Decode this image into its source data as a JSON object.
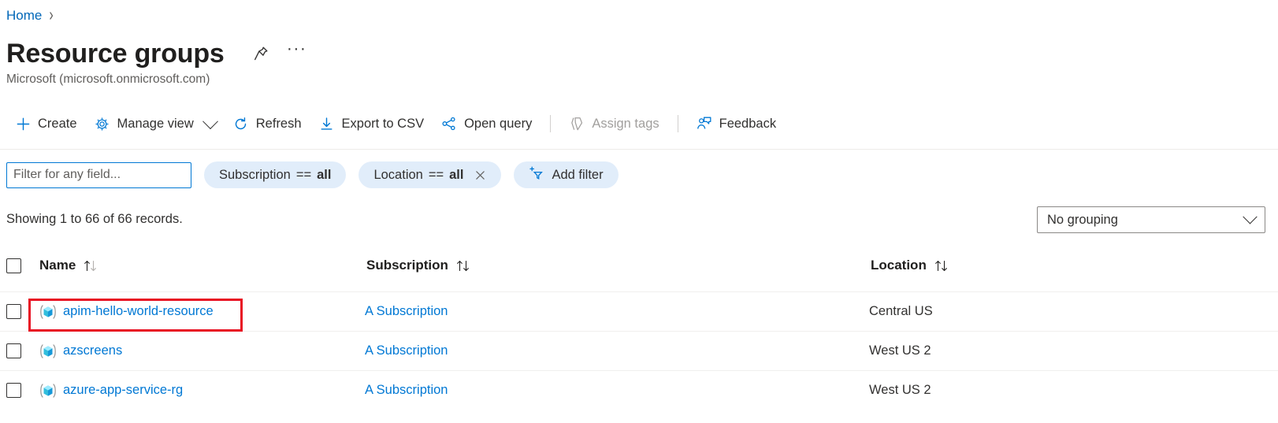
{
  "breadcrumb": {
    "home": "Home",
    "separator": "›"
  },
  "header": {
    "title": "Resource groups",
    "subtitle": "Microsoft (microsoft.onmicrosoft.com)",
    "pin_icon": "pin-icon",
    "more_icon": "ellipsis-icon",
    "more_label": "···"
  },
  "commandbar": {
    "items": [
      {
        "label": "Create",
        "icon": "plus-icon",
        "disabled": false,
        "chevron": false
      },
      {
        "label": "Manage view",
        "icon": "gear-icon",
        "disabled": false,
        "chevron": true
      },
      {
        "label": "Refresh",
        "icon": "refresh-icon",
        "disabled": false,
        "chevron": false
      },
      {
        "label": "Export to CSV",
        "icon": "download-icon",
        "disabled": false,
        "chevron": false
      },
      {
        "label": "Open query",
        "icon": "open-query-icon",
        "disabled": false,
        "chevron": false
      },
      {
        "label": "Assign tags",
        "icon": "tag-icon",
        "disabled": true,
        "chevron": false
      },
      {
        "label": "Feedback",
        "icon": "feedback-icon",
        "disabled": false,
        "chevron": false
      }
    ]
  },
  "filters": {
    "search_placeholder": "Filter for any field...",
    "search_value": "",
    "pills": [
      {
        "field": "Subscription",
        "operator": "==",
        "value": "all",
        "removable": false
      },
      {
        "field": "Location",
        "operator": "==",
        "value": "all",
        "removable": true
      }
    ],
    "add_filter_label": "Add filter",
    "add_filter_icon": "add-filter-icon",
    "remove_icon": "close-icon"
  },
  "summary": {
    "records_text": "Showing 1 to 66 of 66 records.",
    "grouping_value": "No grouping",
    "grouping_chevron": "chevron-down-icon"
  },
  "table": {
    "columns": [
      {
        "label": "Name",
        "sortable": true
      },
      {
        "label": "Subscription",
        "sortable": true
      },
      {
        "label": "Location",
        "sortable": true
      }
    ],
    "sort_icon": "sort-arrows-icon",
    "resource_icon": "resource-group-icon",
    "rows": [
      {
        "name": "",
        "subscription": "",
        "location": "",
        "clipped": true,
        "highlighted": false
      },
      {
        "name": "apim-hello-world-resource",
        "subscription": "A Subscription",
        "location": "Central US",
        "clipped": false,
        "highlighted": true
      },
      {
        "name": "azscreens",
        "subscription": "A Subscription",
        "location": "West US 2",
        "clipped": false,
        "highlighted": false
      },
      {
        "name": "azure-app-service-rg",
        "subscription": "A Subscription",
        "location": "West US 2",
        "clipped": false,
        "highlighted": false
      }
    ]
  },
  "colors": {
    "link": "#0078d4",
    "breadcrumb_link": "#0067b8",
    "pill_bg": "#e1edfa",
    "highlight_border": "#e81123",
    "disabled_text": "#a19f9d"
  }
}
